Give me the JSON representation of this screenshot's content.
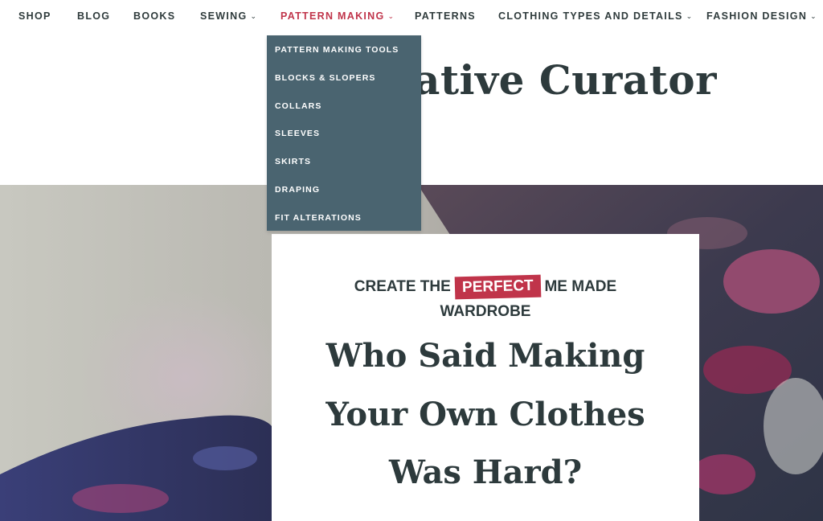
{
  "nav": {
    "items": [
      {
        "label": "SHOP",
        "dropdown": false
      },
      {
        "label": "BLOG",
        "dropdown": false
      },
      {
        "label": "BOOKS",
        "dropdown": false
      },
      {
        "label": "SEWING",
        "dropdown": true
      },
      {
        "label": "PATTERN MAKING",
        "dropdown": true,
        "active": true
      },
      {
        "label": "PATTERNS",
        "dropdown": false
      },
      {
        "label": "CLOTHING TYPES AND DETAILS",
        "dropdown": true
      },
      {
        "label": "FASHION DESIGN",
        "dropdown": true
      }
    ],
    "chevron": "⌄"
  },
  "dropdown": {
    "items": [
      "PATTERN MAKING TOOLS",
      "BLOCKS & SLOPERS",
      "COLLARS",
      "SLEEVES",
      "SKIRTS",
      "DRAPING",
      "FIT ALTERATIONS"
    ]
  },
  "site": {
    "title_visible": "eative Curator"
  },
  "hero": {
    "kicker_pre": "CREATE THE",
    "kicker_badge": "PERFECT",
    "kicker_post": "ME MADE",
    "kicker_line2": "WARDROBE",
    "headline_1": "Who Said Making",
    "headline_2": "Your Own Clothes",
    "headline_3": "Was Hard?"
  },
  "colors": {
    "accent": "#c0344a",
    "dropdown_bg": "#4a6470",
    "text_dark": "#2d3a3c"
  }
}
